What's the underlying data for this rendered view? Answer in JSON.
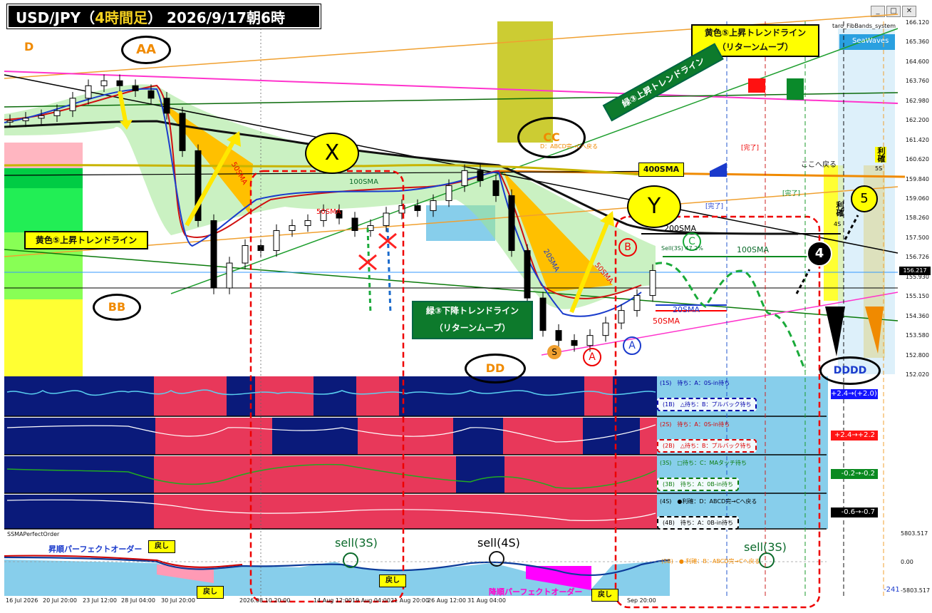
{
  "title": {
    "prefix": "USD/JPY（",
    "highlight": "4時間足",
    "suffix": "） 2026/9/17朝6時"
  },
  "window_buttons": [
    "_",
    "□",
    "✕"
  ],
  "indicator_name": "taro_FibBands_system",
  "seawaves": "SeaWaves",
  "current_price": "156.217",
  "price_axis": [
    "166.120",
    "165.360",
    "164.600",
    "163.760",
    "162.980",
    "162.200",
    "161.420",
    "160.620",
    "159.840",
    "159.060",
    "158.260",
    "157.500",
    "156.726",
    "155.930",
    "155.150",
    "154.360",
    "153.580",
    "152.800",
    "152.020"
  ],
  "time_axis": [
    "16 Jul 2026",
    "20 Jul 20:00",
    "23 Jul 12:00",
    "28 Jul 04:00",
    "30 Jul 20:00",
    "2026.08.10 20:00",
    "14 Aug 12:00",
    "19 Aug 04:00",
    "21 Aug 20:00",
    "26 Aug 12:00",
    "31 Aug 04:00",
    "Sep 20:00"
  ],
  "labels": {
    "D": "D",
    "AA": "AA",
    "BB": "BB",
    "X": "X",
    "Y": "Y",
    "CC": "CC",
    "DD": "DD",
    "DDDD": "DDDD",
    "A1": "A",
    "A2": "A",
    "B": "B",
    "C": "C",
    "S": "S",
    "n4": "4",
    "n5": "5",
    "yellow5_up": "黄色⑤上昇トレンドライン",
    "yellow5_return_1": "黄色⑤上昇トレンドライン",
    "yellow5_return_2": "（リターンムーブ）",
    "green3_up": "緑③上昇トレンドライン",
    "green3_down_1": "緑③下降トレンドライン",
    "green3_down_2": "（リターンムーブ）",
    "sma400": "400SMA",
    "sma200": "200SMA",
    "sma100": "100SMA",
    "sma20": "20SMA",
    "sma50": "50SMA",
    "sma50_a": "50SMA",
    "sma50_b": "50SMA",
    "sma100_a": "100SMA",
    "sma20_a": "20SMA",
    "sma50_c": "50SMA",
    "kanryo1": "[完了]",
    "kanryo2": "[完了]",
    "kanryo3": "[完了]",
    "kokohe": "ここへ戻る",
    "rikaku": "利確",
    "rikaku2": "利確",
    "rikaku_4s": "4S",
    "rikaku_5s": "5S",
    "sell_note": "Sell(3S) 47.2%",
    "abcd_note": "D：ABCD完→Cへ戻る",
    "perfect_order": "SSMAPerfectOrder",
    "up_perfect": "昇順パーフェクトオーダー",
    "down_perfect": "降順パーフェクトオーダー",
    "modoshi": "戻し",
    "sell3s_a": "sell(3S)",
    "sell4s": "sell(4S)",
    "sell3s_b": "sell(3S)"
  },
  "panels": [
    {
      "top_label": "(1S)　待ち：A：0S-in待ち",
      "bottom_label": "(1B)　△待ち：B：プルバック待ち",
      "value": "+2.4→(+2.0)",
      "color": "#1414ff",
      "note_color": "#0000aa"
    },
    {
      "top_label": "(2S)　待ち：A：0S-in待ち",
      "bottom_label": "(2B)　△待ち：B：プルバック待ち",
      "value": "+2.4→+2.2",
      "color": "#ff1414",
      "note_color": "#dd0000"
    },
    {
      "top_label": "(3S)　□待ち：C：MAタッチ待ち",
      "bottom_label": "(3B)　待ち：A：0B-in待ち",
      "value": "-0.2→-0.2",
      "color": "#0a8a20",
      "note_color": "#0a7a0a"
    },
    {
      "top_label": "(4S)　●利確：D：ABCD完→Cへ戻る",
      "bottom_label": "(4B)　待ち：A：0B-in待ち",
      "value": "-0.6→-0.7",
      "color": "#000000",
      "note_color": "#000000"
    }
  ],
  "po_axis": {
    "top": "5803.517",
    "mid": "0.00",
    "bottom": "-5803.517",
    "current": "-241"
  },
  "po_note": "(5B)　● 利確：B：ABCD完→Cへ戻る",
  "chart_data": {
    "type": "line",
    "title": "USD/JPY（4時間足） 2026/9/17朝6時",
    "ylim": [
      152.02,
      166.12
    ],
    "series": [
      {
        "name": "",
        "values": [
          162.2,
          162.3,
          162.4,
          162.6,
          163.1,
          163.6,
          163.8,
          163.6,
          163.4,
          163.1,
          162.5,
          161.0,
          158.2,
          155.5,
          156.5,
          157.2,
          157.0,
          157.8,
          158.0,
          158.2,
          158.6,
          158.3,
          157.8,
          158.0,
          158.5,
          158.8,
          158.6,
          159.0,
          159.6,
          160.2,
          159.8,
          159.2,
          157.0,
          155.1,
          153.8,
          153.4,
          153.2,
          153.6,
          154.1,
          154.6,
          155.2,
          156.2
        ]
      }
    ]
  }
}
